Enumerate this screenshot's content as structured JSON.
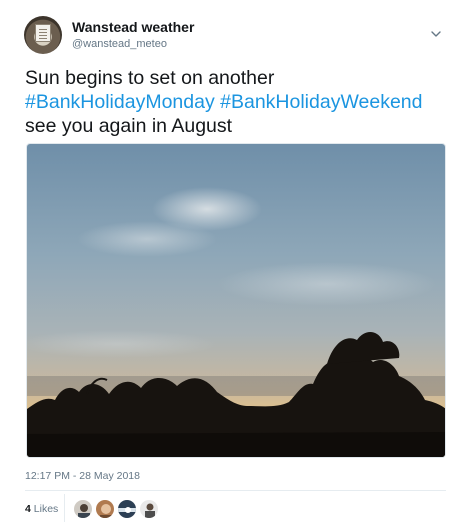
{
  "tweet": {
    "author": {
      "name": "Wanstead weather",
      "handle": "@wanstead_meteo"
    },
    "text": {
      "line1": "Sun begins to set on another",
      "hashtag1": "#BankHolidayMonday",
      "hashtag2": "#BankHolidayWeekend",
      "line3": "see you again in August"
    },
    "media": {
      "description_icon": "sunset-photo"
    },
    "timestamp": "12:17 PM - 28 May 2018",
    "likes": {
      "count": "4",
      "label": "Likes"
    },
    "colors": {
      "hashtag": "#1b95e0",
      "text": "#14171a",
      "muted": "#657786"
    }
  }
}
